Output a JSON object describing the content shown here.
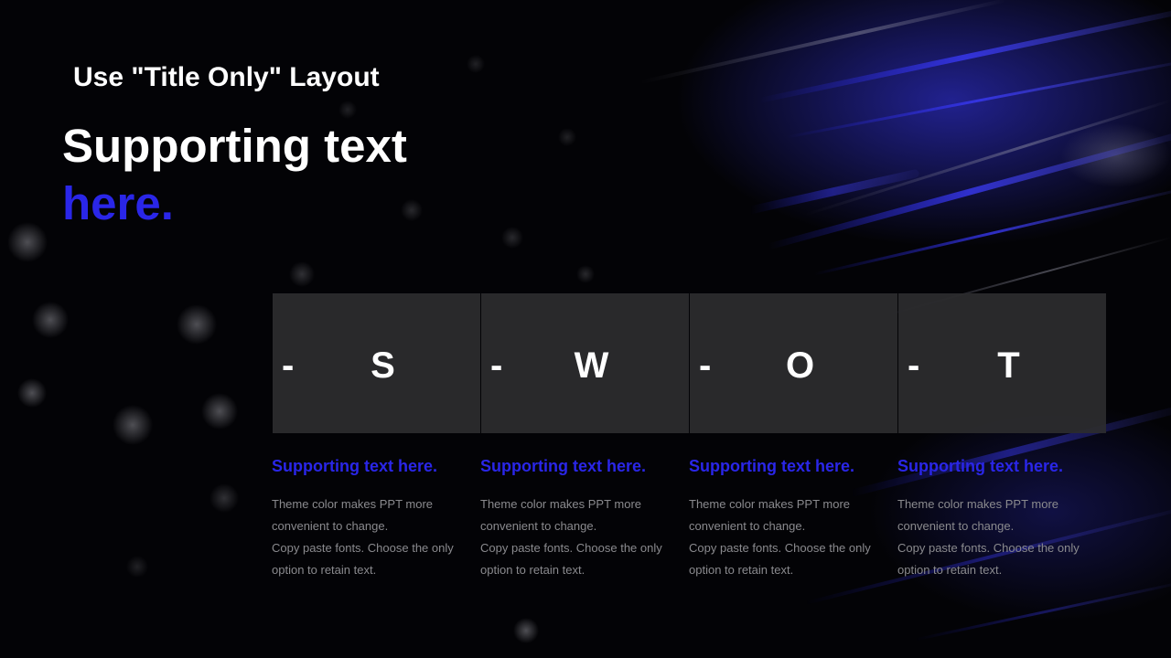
{
  "slide": {
    "layout_title": "Use \"Title Only\" Layout",
    "headline_line1": "Supporting text",
    "headline_line2": "here.",
    "colors": {
      "background": "#030306",
      "accent": "#2a26e8",
      "box": "#2c2c2e",
      "body_text": "#8a8a8e",
      "title_text": "#ffffff"
    }
  },
  "swot": [
    {
      "dash": "-",
      "letter": "S",
      "heading": "Supporting text here.",
      "body_lines": [
        "Theme  color makes PPT more",
        "convenient  to change.",
        "Copy paste  fonts. Choose the only",
        "option to retain text."
      ]
    },
    {
      "dash": "-",
      "letter": "W",
      "heading": "Supporting text here.",
      "body_lines": [
        "Theme  color makes PPT more",
        "convenient  to change.",
        "Copy paste  fonts. Choose the only",
        "option to retain text."
      ]
    },
    {
      "dash": "-",
      "letter": "O",
      "heading": "Supporting text here.",
      "body_lines": [
        "Theme  color makes PPT more",
        "convenient  to change.",
        "Copy paste  fonts. Choose the only",
        "option to retain text."
      ]
    },
    {
      "dash": "-",
      "letter": "T",
      "heading": "Supporting text here.",
      "body_lines": [
        "Theme  color makes PPT more",
        "convenient  to change.",
        "Copy paste  fonts. Choose the only",
        "option to retain text."
      ]
    }
  ]
}
